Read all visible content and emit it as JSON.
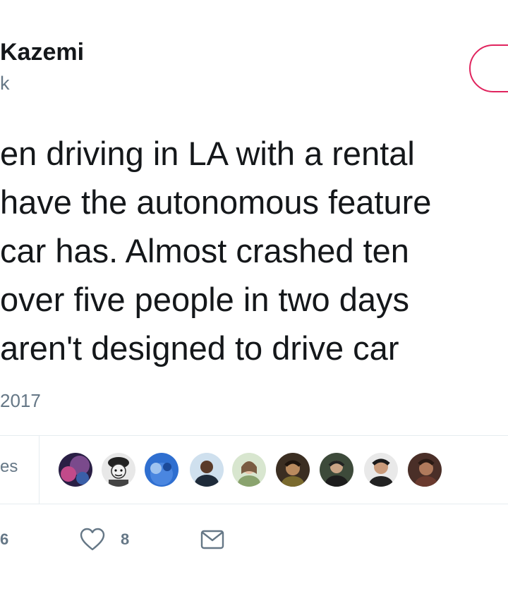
{
  "tweet": {
    "author_name": "Kazemi",
    "author_handle": "k",
    "text_lines": [
      "en driving in LA with a rental",
      "have the autonomous feature",
      "car has. Almost crashed ten",
      "over five people in two days",
      "aren't designed to drive car"
    ],
    "timestamp": "2017",
    "likes_label": "es"
  },
  "actions": {
    "retweet_count": "6",
    "like_count": "8"
  },
  "icons": {
    "like": "heart-outline-icon",
    "message": "envelope-icon"
  },
  "colors": {
    "text": "#14171a",
    "secondary": "#657786",
    "follow_border": "#e0245e",
    "divider": "#e6ecf0"
  }
}
